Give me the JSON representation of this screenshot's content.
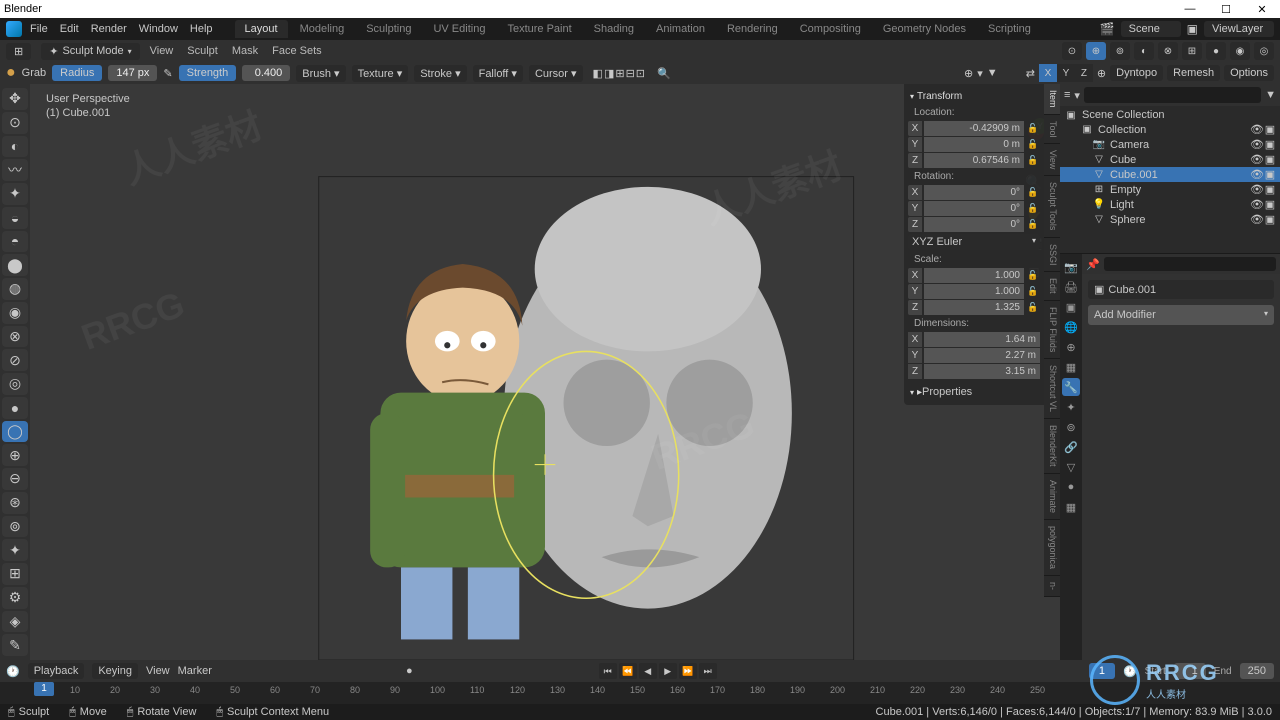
{
  "app": {
    "title": "Blender"
  },
  "window": {
    "min": "—",
    "max": "☐",
    "close": "✕"
  },
  "filemenu": [
    "File",
    "Edit",
    "Render",
    "Window",
    "Help"
  ],
  "workspaces": [
    "Layout",
    "Modeling",
    "Sculpting",
    "UV Editing",
    "Texture Paint",
    "Shading",
    "Animation",
    "Rendering",
    "Compositing",
    "Geometry Nodes",
    "Scripting"
  ],
  "workspace_active": "Layout",
  "scene": {
    "label": "Scene",
    "viewlayer": "ViewLayer"
  },
  "mode": {
    "icon": "✦",
    "label": "Sculpt Mode"
  },
  "viewmenus": [
    "View",
    "Sculpt",
    "Mask",
    "Face Sets"
  ],
  "tool": {
    "brush_icon": "●",
    "name": "Grab",
    "radius_label": "Radius",
    "radius": "147 px",
    "strength_label": "Strength",
    "strength": "0.400",
    "dropdowns": [
      "Brush",
      "Texture",
      "Stroke",
      "Falloff",
      "Cursor"
    ]
  },
  "toolhdr_right": {
    "dyntopo": "Dyntopo",
    "remesh": "Remesh",
    "options": "Options",
    "axes": {
      "x": "X",
      "y": "Y",
      "z": "Z"
    }
  },
  "viewport": {
    "perspective": "User Perspective",
    "object": "(1) Cube.001",
    "side_tabs": [
      "Item",
      "Tool",
      "View",
      "Sculpt Tools",
      "SSGI",
      "Edit",
      "FLIP Fluids",
      "Shortcut VL",
      "BlenderKit",
      "Animate",
      "polygonica",
      "n-"
    ]
  },
  "npanel": {
    "transform": "Transform",
    "location": "Location:",
    "loc": {
      "x": "-0.42909 m",
      "y": "0 m",
      "z": "0.67546 m"
    },
    "rotation": "Rotation:",
    "rot": {
      "x": "0°",
      "y": "0°",
      "z": "0°"
    },
    "rotmode": "XYZ Euler",
    "scale": "Scale:",
    "scl": {
      "x": "1.000",
      "y": "1.000",
      "z": "1.325"
    },
    "dimensions": "Dimensions:",
    "dim": {
      "x": "1.64 m",
      "y": "2.27 m",
      "z": "3.15 m"
    },
    "properties": "Properties"
  },
  "outliner": {
    "title": "Scene Collection",
    "items": [
      {
        "name": "Collection",
        "indent": 1,
        "icon": "▣",
        "sel": false
      },
      {
        "name": "Camera",
        "indent": 2,
        "icon": "📷",
        "sel": false
      },
      {
        "name": "Cube",
        "indent": 2,
        "icon": "▽",
        "sel": false
      },
      {
        "name": "Cube.001",
        "indent": 2,
        "icon": "▽",
        "sel": true
      },
      {
        "name": "Empty",
        "indent": 2,
        "icon": "⊞",
        "sel": false
      },
      {
        "name": "Light",
        "indent": 2,
        "icon": "💡",
        "sel": false
      },
      {
        "name": "Sphere",
        "indent": 2,
        "icon": "▽",
        "sel": false
      }
    ]
  },
  "props": {
    "object": "Cube.001",
    "addmod": "Add Modifier"
  },
  "timeline": {
    "playback": "Playback",
    "keying": "Keying",
    "view": "View",
    "marker": "Marker",
    "frame": "1",
    "start_lbl": "Start",
    "start": "1",
    "end_lbl": "End",
    "end": "250",
    "ticks": [
      10,
      20,
      30,
      40,
      50,
      60,
      70,
      80,
      90,
      100,
      110,
      120,
      130,
      140,
      150,
      160,
      170,
      180,
      190,
      200,
      210,
      220,
      230,
      240,
      250
    ]
  },
  "status": {
    "sculpt": "Sculpt",
    "move": "Move",
    "rotate": "Rotate View",
    "context": "Sculpt Context Menu",
    "right": "Cube.001 | Verts:6,146/0 | Faces:6,144/0 | Objects:1/7 | Memory: 83.9 MiB | 3.0.0"
  },
  "sculpt_tools": [
    "✥",
    "⊙",
    "◐",
    "〰",
    "✦",
    "◒",
    "◓",
    "⬤",
    "◍",
    "◉",
    "⊗",
    "⊘",
    "◎",
    "●",
    "◯",
    "⊕",
    "⊖",
    "⊛",
    "⊚",
    "✦",
    "⊞",
    "⚙",
    "◈",
    "✎"
  ]
}
